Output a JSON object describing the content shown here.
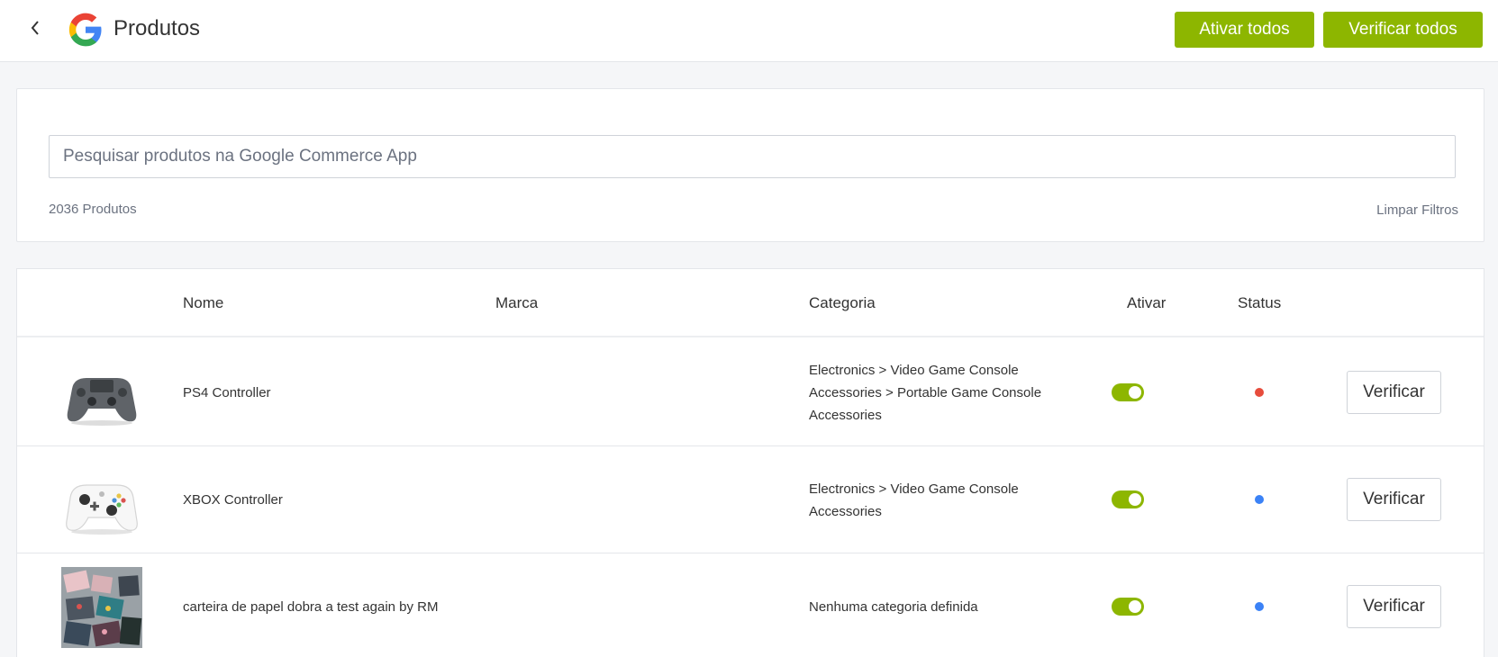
{
  "header": {
    "title": "Produtos",
    "activate_all_label": "Ativar todos",
    "verify_all_label": "Verificar todos",
    "accent_color": "#8db600"
  },
  "search": {
    "placeholder": "Pesquisar produtos na Google Commerce App",
    "value": "",
    "count_text": "2036 Produtos",
    "clear_filters_label": "Limpar Filtros"
  },
  "table": {
    "columns": {
      "name": "Nome",
      "brand": "Marca",
      "category": "Categoria",
      "activate": "Ativar",
      "status": "Status"
    },
    "rows": [
      {
        "name": "PS4 Controller",
        "brand": "",
        "category": "Electronics > Video Game Console Accessories > Portable Game Console Accessories",
        "active": true,
        "status_color": "#e74c3c",
        "verify_label": "Verificar",
        "thumb_icon": "ps4-controller-image"
      },
      {
        "name": "XBOX Controller",
        "brand": "",
        "category": "Electronics > Video Game Console Accessories",
        "active": true,
        "status_color": "#3b82f6",
        "verify_label": "Verificar",
        "thumb_icon": "xbox-controller-image"
      },
      {
        "name": "carteira de papel dobra a test again by RM",
        "brand": "",
        "category": "Nenhuma categoria definida",
        "active": true,
        "status_color": "#3b82f6",
        "verify_label": "Verificar",
        "thumb_icon": "paper-wallet-image"
      }
    ]
  }
}
